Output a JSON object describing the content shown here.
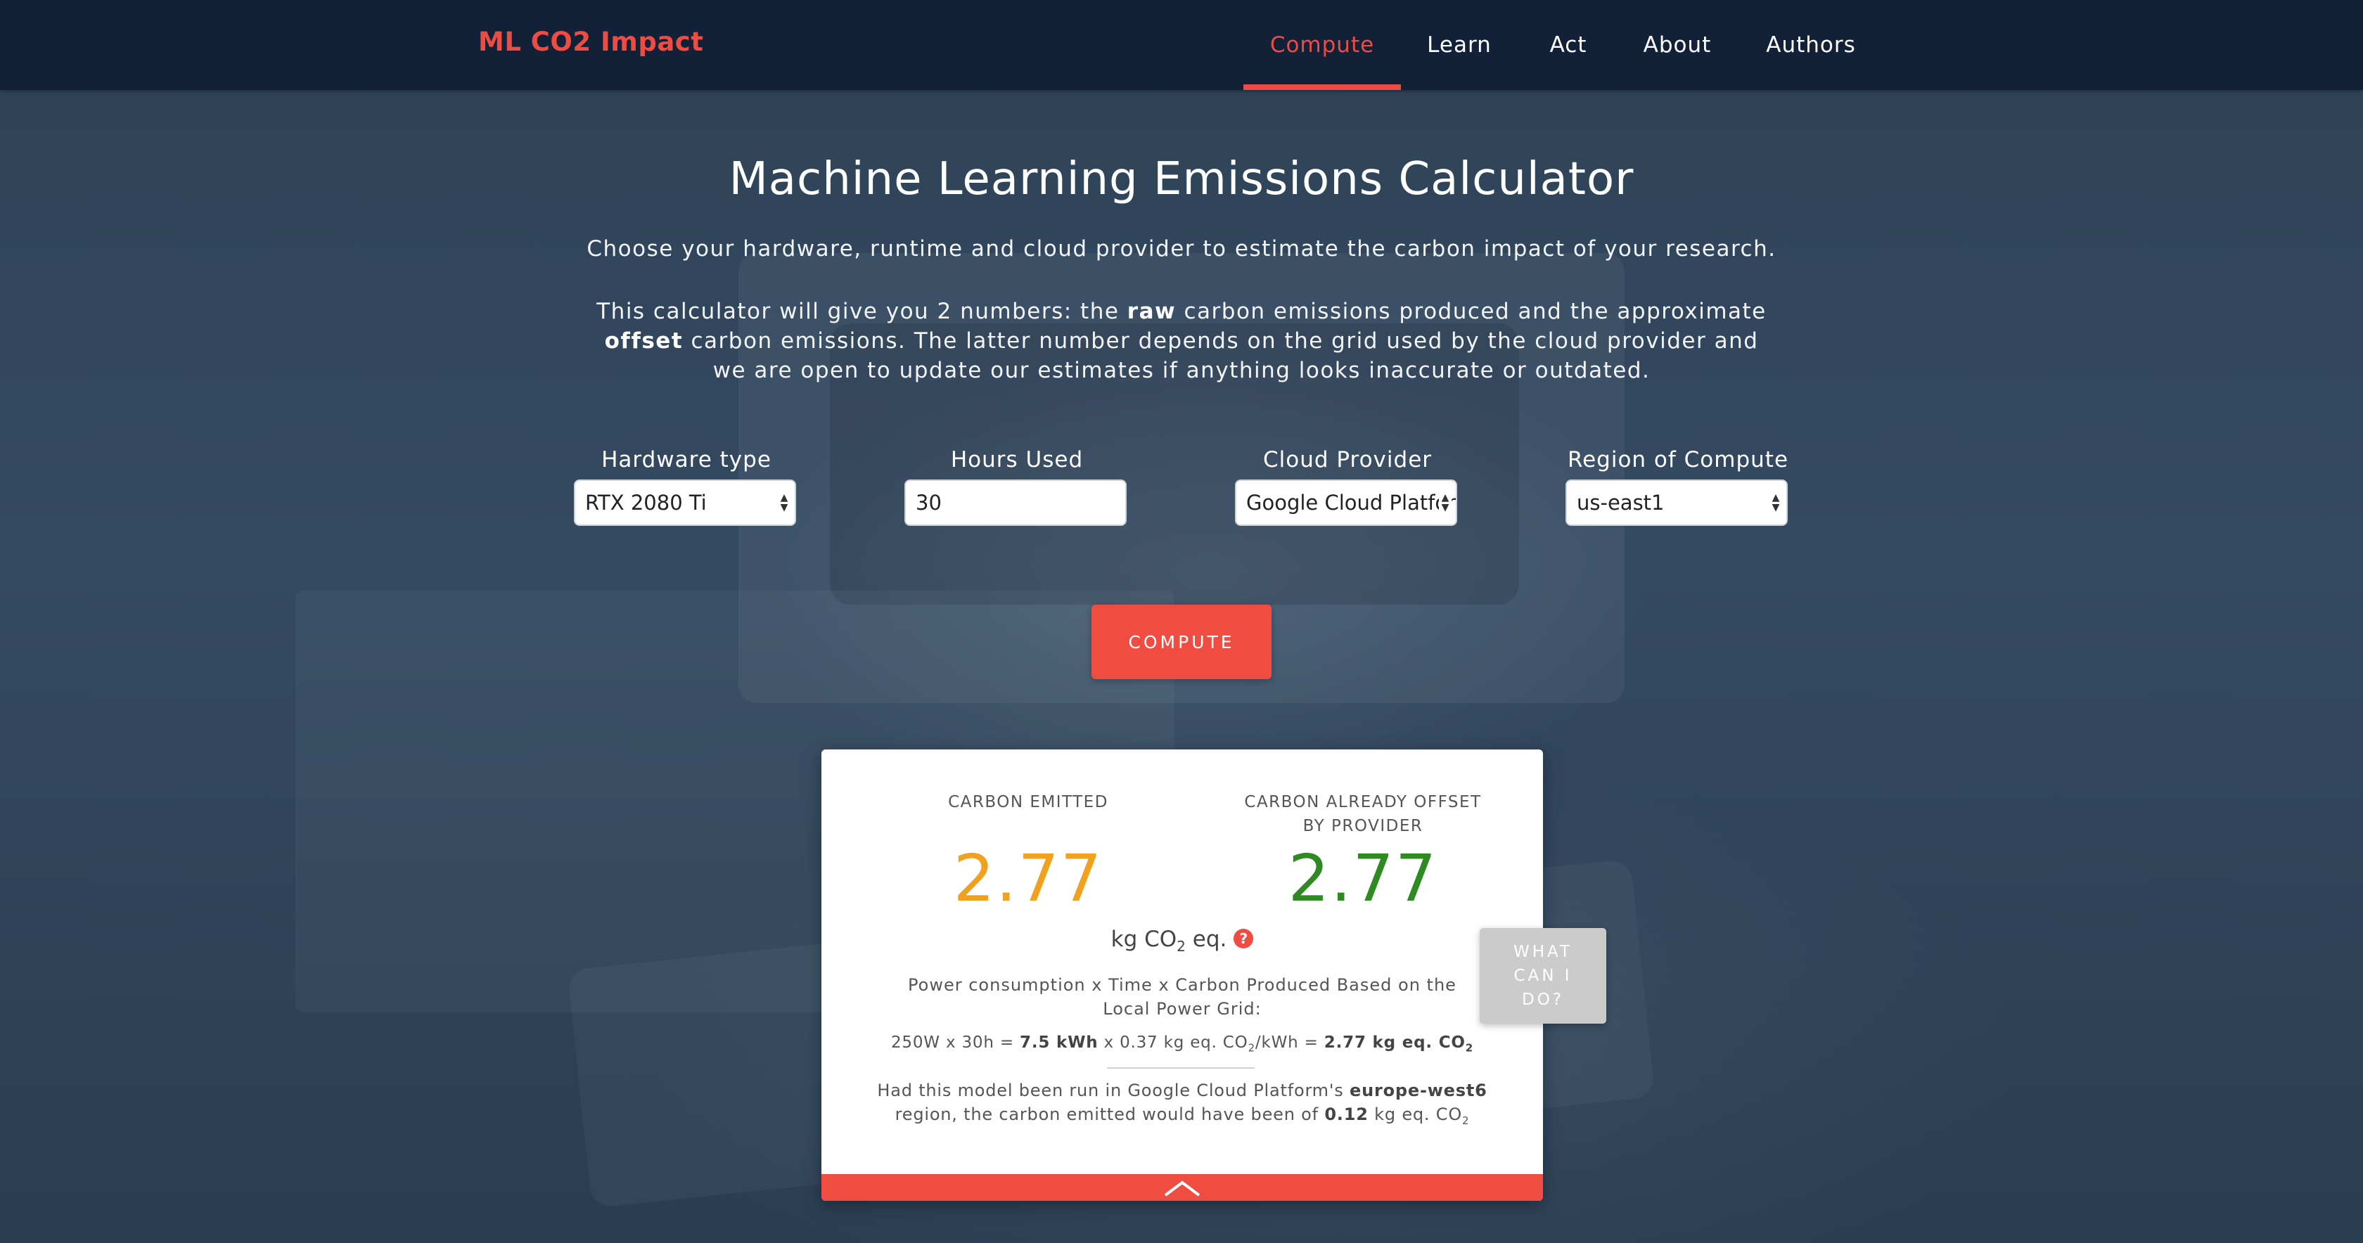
{
  "brand": "ML CO2 Impact",
  "nav": {
    "items": [
      "Compute",
      "Learn",
      "Act",
      "About",
      "Authors"
    ],
    "active": "Compute"
  },
  "header": {
    "title": "Machine Learning Emissions Calculator",
    "intro": "Choose your hardware, runtime and cloud provider to estimate the carbon impact of your research.",
    "explain_1": "This calculator will give you 2 numbers: the ",
    "explain_raw": "raw",
    "explain_2": " carbon emissions produced and the approximate ",
    "explain_offset": "offset",
    "explain_3": " carbon emissions. The latter number depends on the grid used by the cloud provider and we are open to update our estimates if anything looks inaccurate or outdated."
  },
  "form": {
    "hardware": {
      "label": "Hardware type",
      "value": "RTX 2080 Ti"
    },
    "hours": {
      "label": "Hours Used",
      "value": "30"
    },
    "provider": {
      "label": "Cloud Provider",
      "value": "Google Cloud Platform"
    },
    "region": {
      "label": "Region of Compute",
      "value": "us-east1"
    },
    "compute_label": "COMPUTE"
  },
  "results": {
    "emitted_label": "CARBON EMITTED",
    "emitted_value": "2.77",
    "offset_label": "CARBON ALREADY OFFSET BY PROVIDER",
    "offset_value": "2.77",
    "units_prefix": "kg CO",
    "units_sub": "2",
    "units_suffix": " eq.",
    "help_icon": "?",
    "formula_description": "Power consumption x Time x Carbon Produced Based on the Local Power Grid:",
    "formula": {
      "power": "250W",
      "x1": " x ",
      "time": "30h",
      "eq1": " = ",
      "energy": "7.5 kWh",
      "x2": " x ",
      "intensity_prefix": "0.37 kg eq. CO",
      "intensity_sub": "2",
      "intensity_suffix": "/kWh",
      "eq2": " = ",
      "total_prefix": "2.77 kg eq. CO",
      "total_sub": "2"
    },
    "alternative": {
      "text_1": "Had this model been run in Google Cloud Platform's ",
      "region": "europe-west6",
      "text_2": " region, the carbon emitted would have been of ",
      "value": "0.12",
      "unit_prefix": " kg eq. CO",
      "unit_sub": "2"
    }
  },
  "what_can_i_do": "WHAT CAN I DO?",
  "colors": {
    "accent": "#f04c42",
    "navbar": "#132138",
    "emitted": "#f2a11f",
    "offset": "#2e8b22",
    "what_button": "#cbcbcb"
  }
}
